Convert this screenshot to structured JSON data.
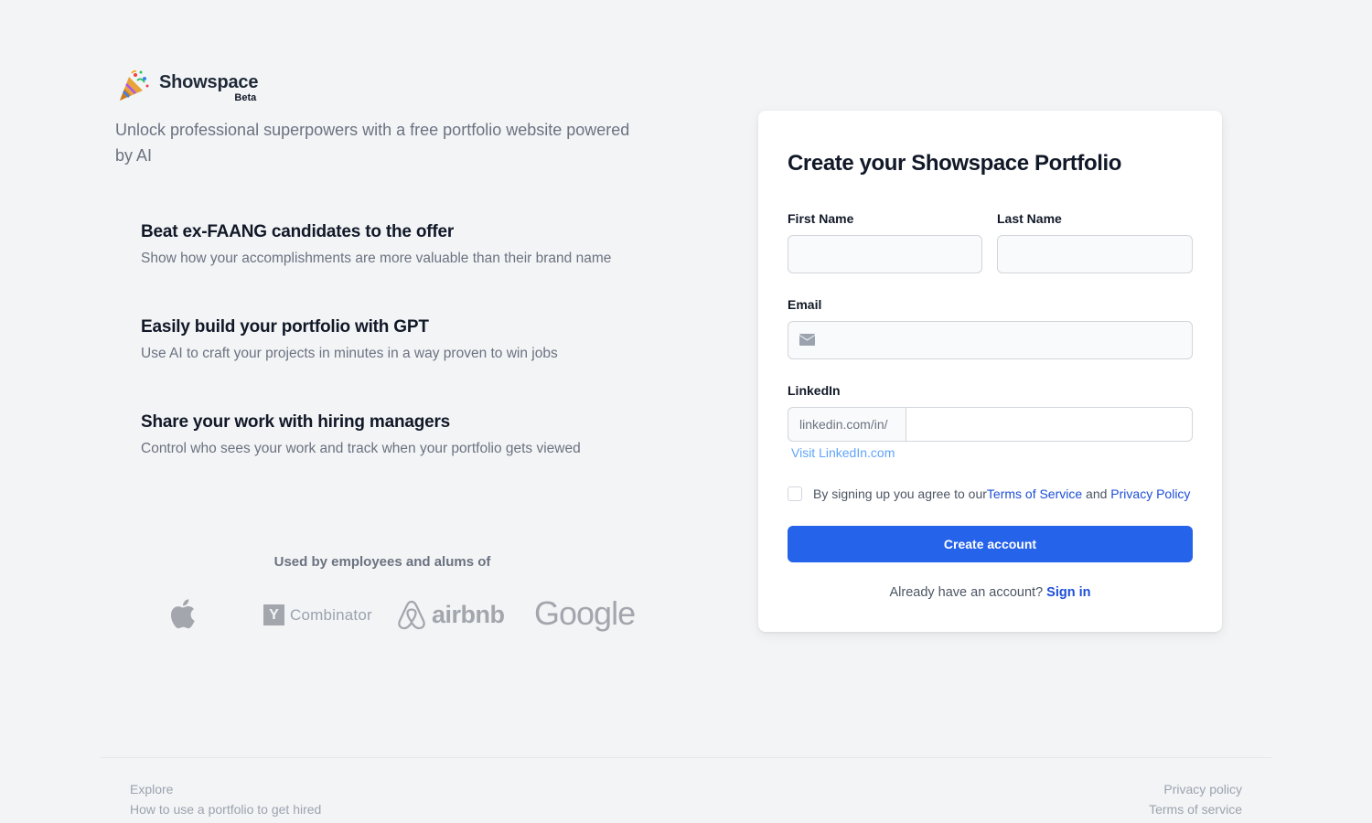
{
  "brand": {
    "name": "Showspace",
    "badge": "Beta",
    "icon": "party-popper-icon"
  },
  "tagline": "Unlock professional superpowers with a free portfolio website powered by AI",
  "features": [
    {
      "title": "Beat ex-FAANG candidates to the offer",
      "description": "Show how your accomplishments are more valuable than their brand name"
    },
    {
      "title": "Easily build your portfolio with GPT",
      "description": "Use AI to craft your projects in minutes in a way proven to win jobs"
    },
    {
      "title": "Share your work with hiring managers",
      "description": "Control who sees your work and track when your portfolio gets viewed"
    }
  ],
  "used_by": {
    "heading": "Used by employees and alums of",
    "logos": [
      {
        "name": "apple-logo"
      },
      {
        "name": "y-combinator-logo",
        "mark": "Y",
        "text": "Combinator"
      },
      {
        "name": "airbnb-logo",
        "text": "airbnb"
      },
      {
        "name": "google-logo",
        "text": "Google"
      }
    ]
  },
  "form": {
    "title": "Create your Showspace Portfolio",
    "first_name": {
      "label": "First Name",
      "value": "",
      "placeholder": ""
    },
    "last_name": {
      "label": "Last Name",
      "value": "",
      "placeholder": ""
    },
    "email": {
      "label": "Email",
      "value": "",
      "placeholder": "",
      "icon": "mail-icon"
    },
    "linkedin": {
      "label": "LinkedIn",
      "prefix": "linkedin.com/in/",
      "value": "",
      "visit_link": "Visit LinkedIn.com"
    },
    "terms": {
      "checked": false,
      "text": "By signing up you agree to our",
      "tos_link": "Terms of Service",
      "and": "and",
      "privacy_link": "Privacy Policy"
    },
    "submit_label": "Create account",
    "signin_prompt": "Already have an account?",
    "signin_link": "Sign in"
  },
  "footer": {
    "left_links": [
      "Explore",
      "How to use a portfolio to get hired"
    ],
    "right_links": [
      "Privacy policy",
      "Terms of service"
    ]
  },
  "colors": {
    "background": "#f3f4f6",
    "primary": "#2563eb",
    "link": "#1d4ed8",
    "muted_text": "#6b7280"
  }
}
